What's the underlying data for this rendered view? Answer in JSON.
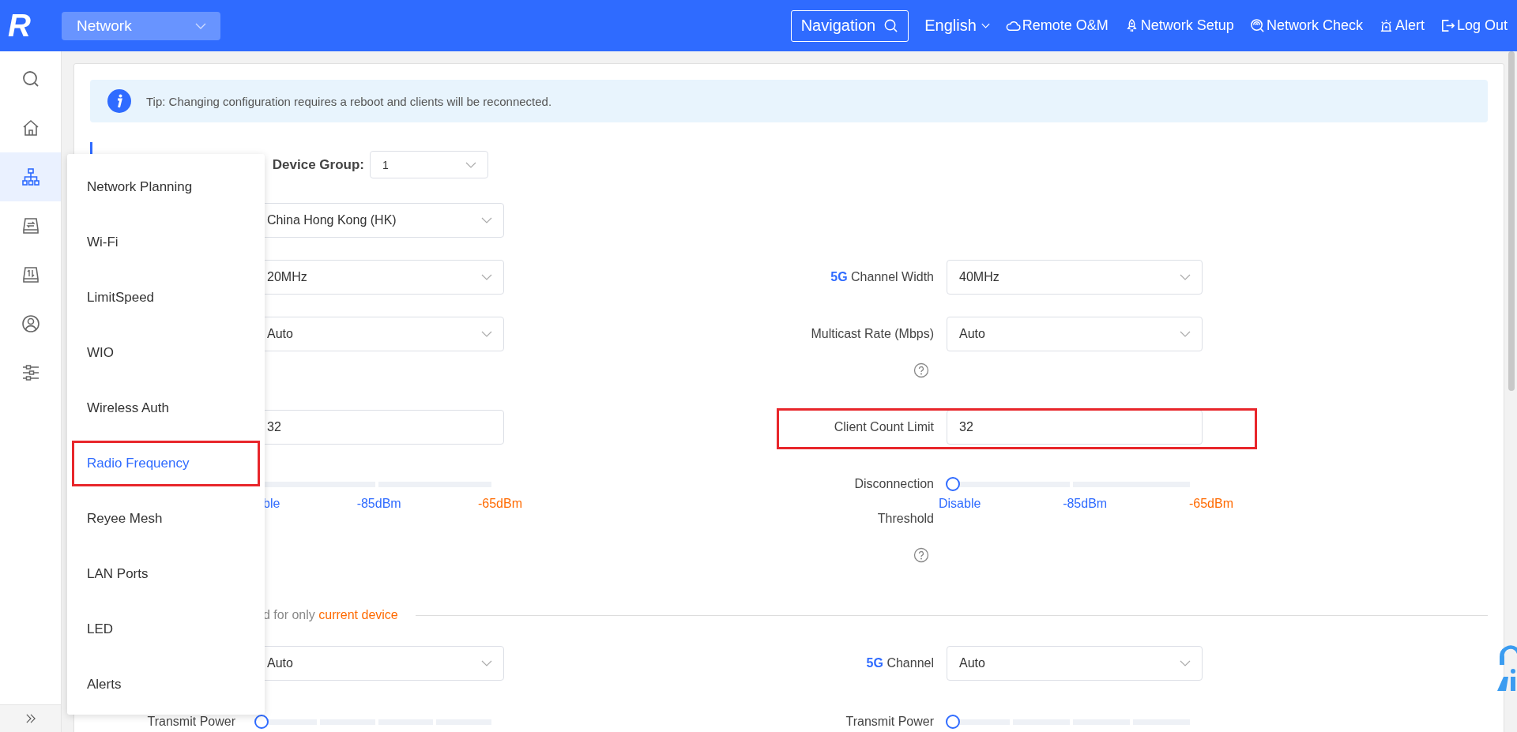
{
  "header": {
    "logo": "R",
    "module": "Network",
    "navigation": "Navigation",
    "language": "English",
    "actions": [
      {
        "kind": "cloud",
        "label": "Remote O&M"
      },
      {
        "kind": "rocket",
        "label": "Network Setup"
      },
      {
        "kind": "scan",
        "label": "Network Check"
      },
      {
        "kind": "siren",
        "label": "Alert"
      },
      {
        "kind": "logout",
        "label": "Log Out"
      }
    ]
  },
  "sidebar": {
    "items": [
      {
        "kind": "search",
        "selected": false
      },
      {
        "kind": "home",
        "selected": false
      },
      {
        "kind": "network",
        "selected": true
      },
      {
        "kind": "device_sync",
        "selected": false
      },
      {
        "kind": "device_flow",
        "selected": false
      },
      {
        "kind": "user",
        "selected": false
      },
      {
        "kind": "sliders",
        "selected": false
      }
    ]
  },
  "tip": "Tip: Changing configuration requires a reboot and clients will be reconnected.",
  "device_group": {
    "label": "Device Group:",
    "value": "1"
  },
  "rows": [
    {
      "left": {
        "kind": "select",
        "value": "China Hong Kong (HK)"
      }
    },
    {
      "left": {
        "kind": "select",
        "value": "20MHz"
      },
      "right": {
        "kind": "select",
        "band": "5G",
        "label": "Channel Width",
        "value": "40MHz"
      }
    },
    {
      "left": {
        "kind": "select",
        "value": "Auto"
      },
      "right": {
        "kind": "select",
        "label": "Multicast Rate (Mbps)",
        "value": "Auto",
        "help": true
      }
    },
    {
      "left": {
        "kind": "input",
        "value": "32"
      },
      "right": {
        "kind": "input",
        "label": "Client Count Limit",
        "value": "32",
        "annotated": true
      }
    },
    {
      "left": {
        "kind": "slider",
        "ticks": [
          {
            "label": "ble",
            "color": "#2f6bff"
          },
          {
            "label": "-85dBm",
            "color": "#2f6bff"
          },
          {
            "label": "-65dBm",
            "color": "#ff6a00"
          }
        ]
      },
      "right": {
        "kind": "slider",
        "label": "Disconnection Threshold",
        "help": true,
        "level": 0,
        "ticks": [
          {
            "label": "Disable",
            "color": "#2f6bff"
          },
          {
            "label": "-85dBm",
            "color": "#2f6bff"
          },
          {
            "label": "-65dBm",
            "color": "#ff6a00"
          }
        ]
      }
    }
  ],
  "section_note": {
    "text": "d for only",
    "highlight": "current device"
  },
  "section_rows": [
    {
      "left": {
        "kind": "select",
        "value": "Auto"
      },
      "right": {
        "kind": "select",
        "band": "5G",
        "label": "Channel",
        "value": "Auto"
      }
    },
    {
      "left": {
        "kind": "slider",
        "label": "Transmit Power",
        "level": 0
      },
      "right": {
        "kind": "slider",
        "label": "Transmit Power",
        "level": 0
      }
    }
  ],
  "menu": {
    "items": [
      {
        "label": "Network Planning",
        "selected": false,
        "annotated": false
      },
      {
        "label": "Wi-Fi",
        "selected": false,
        "annotated": false
      },
      {
        "label": "LimitSpeed",
        "selected": false,
        "annotated": false
      },
      {
        "label": "WIO",
        "selected": false,
        "annotated": false
      },
      {
        "label": "Wireless Auth",
        "selected": false,
        "annotated": false
      },
      {
        "label": "Radio Frequency",
        "selected": true,
        "annotated": true
      },
      {
        "label": "Reyee Mesh",
        "selected": false,
        "annotated": false
      },
      {
        "label": "LAN Ports",
        "selected": false,
        "annotated": false
      },
      {
        "label": "LED",
        "selected": false,
        "annotated": false
      },
      {
        "label": "Alerts",
        "selected": false,
        "annotated": false
      }
    ]
  }
}
